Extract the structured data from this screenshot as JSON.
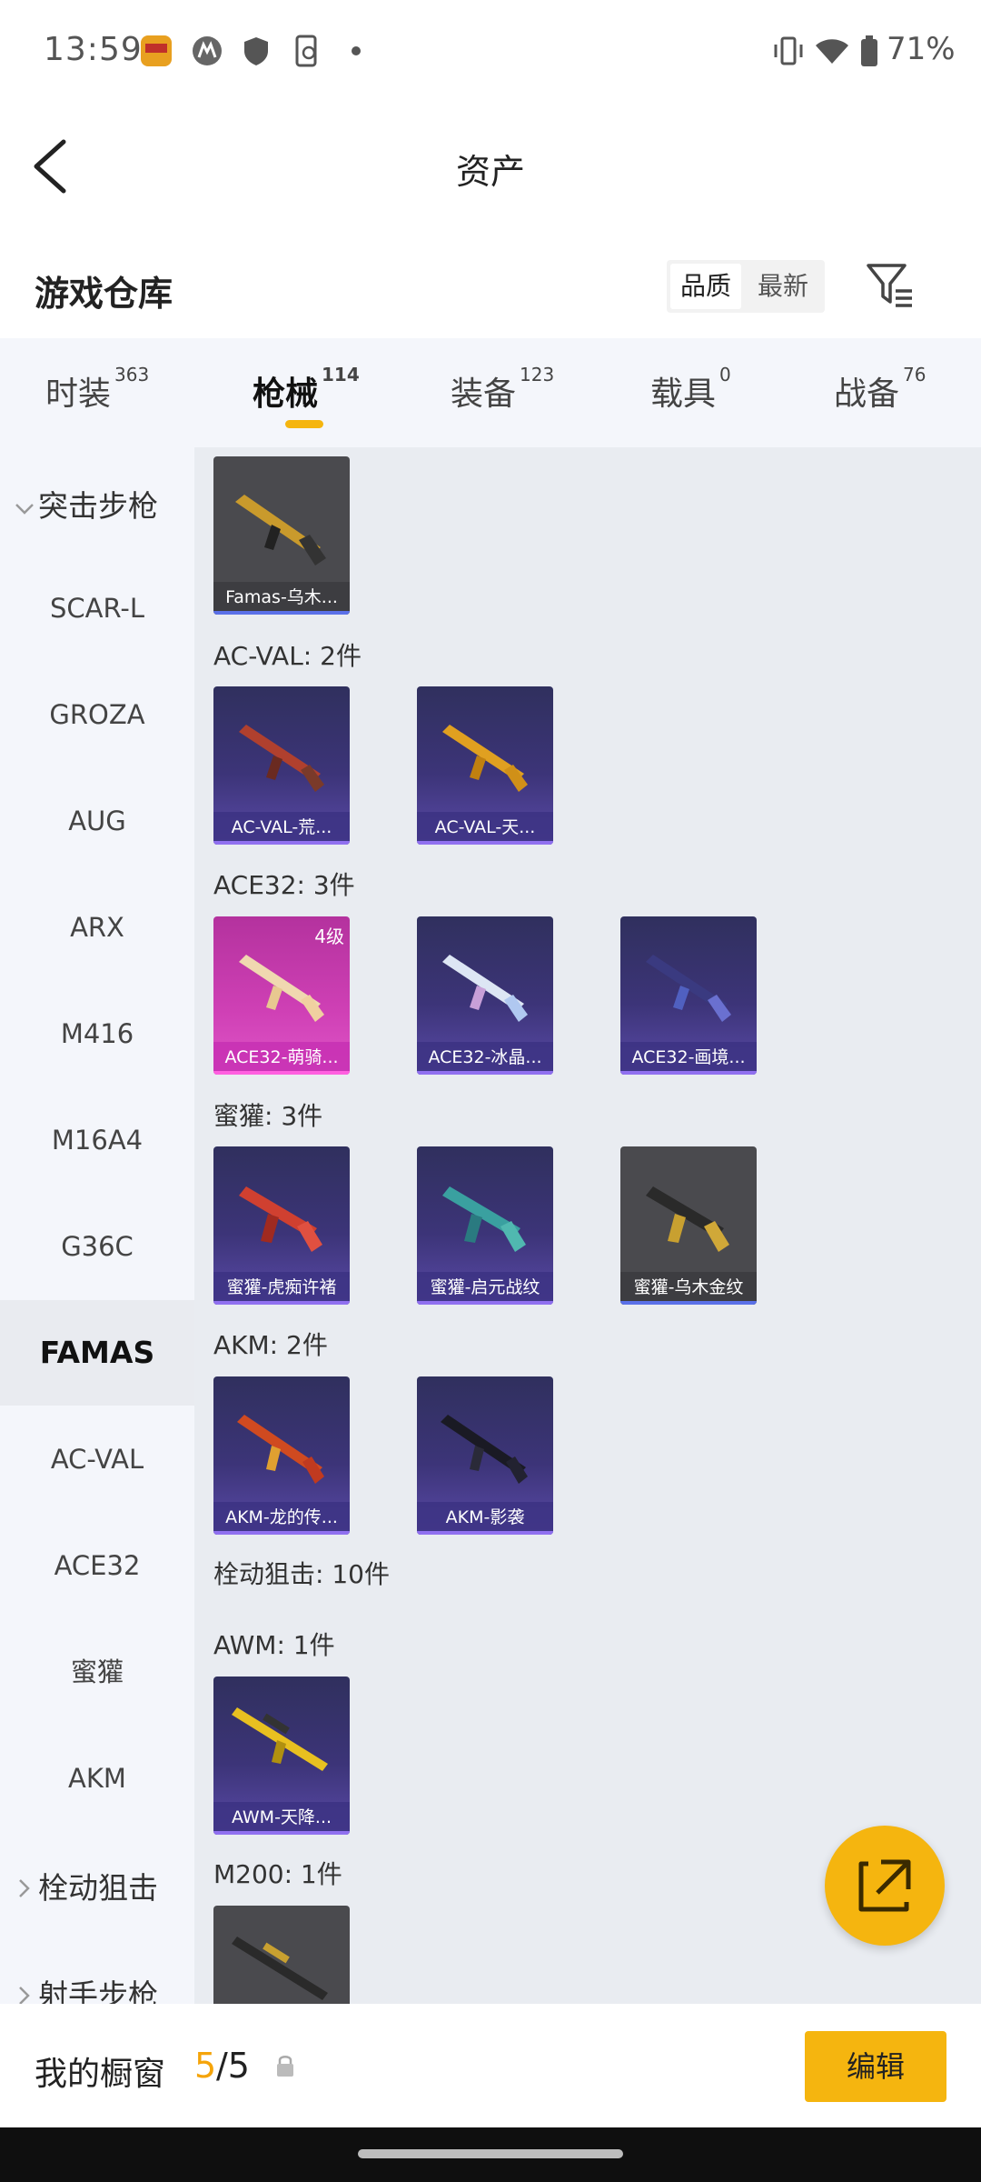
{
  "status_bar": {
    "time": "13:59",
    "battery": "71%"
  },
  "header": {
    "title": "资产",
    "back_icon": "chevron-left-icon"
  },
  "warehouse": {
    "title": "游戏仓库",
    "sort_quality": "品质",
    "sort_newest": "最新",
    "filter_icon": "filter-icon"
  },
  "tabs": [
    {
      "label": "时装",
      "count": "363"
    },
    {
      "label": "枪械",
      "count": "114"
    },
    {
      "label": "装备",
      "count": "123"
    },
    {
      "label": "载具",
      "count": "0"
    },
    {
      "label": "战备",
      "count": "76"
    }
  ],
  "sidebar": {
    "group_assault": "突击步枪",
    "items": [
      "SCAR-L",
      "GROZA",
      "AUG",
      "ARX",
      "M416",
      "M16A4",
      "G36C",
      "FAMAS",
      "AC-VAL",
      "ACE32",
      "蜜獾",
      "AKM"
    ],
    "group_bolt": "栓动狙击",
    "group_marksman": "射手步枪"
  },
  "main": {
    "top_card": "Famas-乌木...",
    "groups": {
      "acval": {
        "header": "AC-VAL: 2件",
        "cards": [
          "AC-VAL-荒...",
          "AC-VAL-天..."
        ]
      },
      "ace32": {
        "header": "ACE32: 3件",
        "cards": [
          "ACE32-萌骑...",
          "ACE32-冰晶...",
          "ACE32-画境..."
        ],
        "badge": "4级"
      },
      "honey": {
        "header": "蜜獾: 3件",
        "cards": [
          "蜜獾-虎痴许褚",
          "蜜獾-启元战纹",
          "蜜獾-乌木金纹"
        ]
      },
      "akm": {
        "header": "AKM: 2件",
        "cards": [
          "AKM-龙的传...",
          "AKM-影袭"
        ]
      },
      "bolt": {
        "header": "栓动狙击: 10件"
      },
      "awm": {
        "header": "AWM: 1件",
        "cards": [
          "AWM-天降..."
        ]
      },
      "m200": {
        "header": "M200: 1件"
      }
    }
  },
  "bottom": {
    "showcase_label": "我的橱窗",
    "showcase_current": "5",
    "showcase_total": "/5",
    "edit_label": "编辑",
    "share_icon": "share-icon"
  }
}
